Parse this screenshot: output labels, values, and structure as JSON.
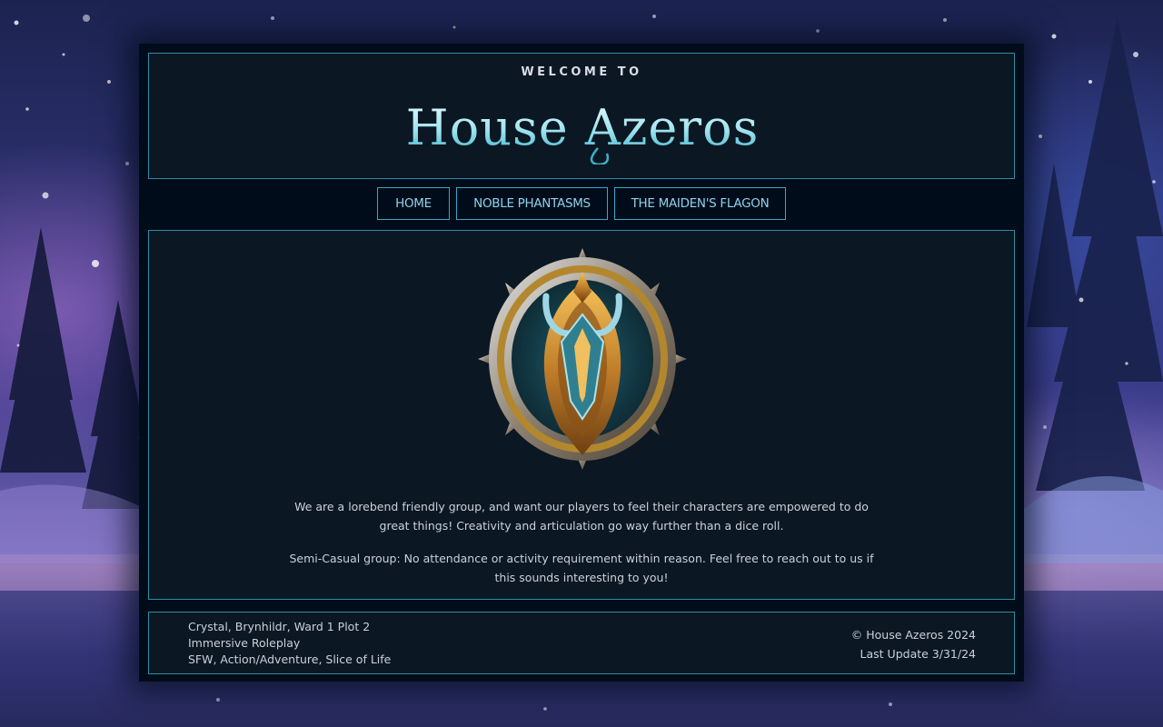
{
  "header": {
    "welcome": "WELCOME TO",
    "title": "House Azeros"
  },
  "nav": {
    "items": [
      {
        "label": "HOME"
      },
      {
        "label": "NOBLE PHANTASMS"
      },
      {
        "label": "THE MAIDEN'S FLAGON"
      }
    ]
  },
  "main": {
    "emblem": "house-crest-emblem",
    "paragraphs": [
      "We are a lorebend friendly group, and want our players to feel their characters are empowered to do great things! Creativity and articulation go way further than a dice roll.",
      "Semi-Casual group: No attendance or activity requirement within reason. Feel free to reach out to us if this sounds interesting to you!"
    ]
  },
  "footer": {
    "left_lines": [
      "Crystal, Brynhildr, Ward 1 Plot 2",
      "Immersive Roleplay",
      "SFW, Action/Adventure, Slice of Life"
    ],
    "copyright": "© House Azeros 2024",
    "last_update": "Last Update 3/31/24"
  },
  "colors": {
    "accent": "#2f8ca6",
    "nav_text": "#8fd2ea",
    "panel_bg": "#0b1722",
    "frame_bg": "#010c1a"
  }
}
